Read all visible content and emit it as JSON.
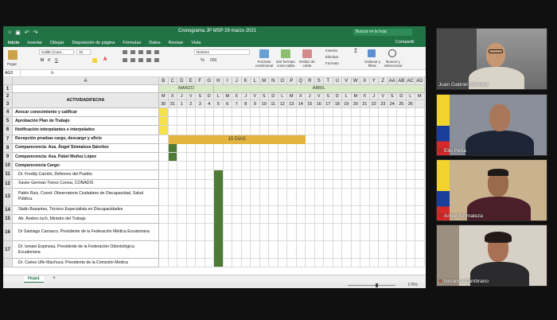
{
  "excel": {
    "qa_icons": [
      "home-icon",
      "save-icon",
      "undo-icon",
      "redo-icon"
    ],
    "title": "Cronograma JP MSP 29 marzo 2021",
    "search_placeholder": "Buscar en la hoja",
    "tabs": [
      "Inicio",
      "Insertar",
      "Dibujar",
      "Disposición de página",
      "Fórmulas",
      "Datos",
      "Revisar",
      "Vista"
    ],
    "share": "Compartir",
    "ribbon": {
      "paste": "Pegar",
      "font": "Calibri (Cuer...",
      "size": "10",
      "number_format": "Número",
      "conditional": "Formato condicional",
      "as_table": "Dar formato como tabla",
      "cell_styles": "Estilos de celda",
      "insert": "Insertar",
      "delete": "Eliminar",
      "format": "Formato",
      "sort": "Ordenar y filtrar",
      "find": "Buscar y seleccionar",
      "bold": "N",
      "italic": "K",
      "underline": "S",
      "font_a": "A",
      "percent": "%",
      "thousands": "000"
    },
    "name_box": "AG3",
    "fx": "fx",
    "grid": {
      "header_a": "A",
      "columns_after_a": [
        "B",
        "C",
        "D",
        "E",
        "F",
        "G",
        "H",
        "I",
        "J",
        "K",
        "L",
        "M",
        "N",
        "O",
        "P",
        "Q",
        "R",
        "S",
        "T",
        "U",
        "V",
        "W",
        "X",
        "Y",
        "Z",
        "AA",
        "AB",
        "AC",
        "AD"
      ],
      "month_marzo": "MARZO",
      "month_abril": "ABRIL",
      "weekdays": [
        "M",
        "X",
        "J",
        "V",
        "S",
        "D",
        "L",
        "M",
        "X",
        "J",
        "V",
        "S",
        "D",
        "L",
        "M",
        "X",
        "J",
        "V",
        "S",
        "D",
        "L",
        "M",
        "X",
        "J",
        "V",
        "S",
        "D",
        "L",
        "M"
      ],
      "days": [
        "30",
        "31",
        "1",
        "2",
        "3",
        "4",
        "5",
        "6",
        "7",
        "8",
        "9",
        "10",
        "11",
        "12",
        "13",
        "14",
        "15",
        "16",
        "17",
        "18",
        "19",
        "20",
        "21",
        "22",
        "23",
        "24",
        "25",
        "26",
        ""
      ],
      "header_label": "ACTIVIDAD/FECHA",
      "bar_label": "15 DÍAS",
      "row_numbers": [
        "1",
        "2",
        "3",
        "4",
        "5",
        "6",
        "7",
        "8",
        "9",
        "10",
        "11",
        "12",
        "13",
        "14",
        "15",
        "16",
        "17"
      ],
      "activities": [
        {
          "row": "4",
          "text": "Avocar conocimiento y calificar",
          "bold": true
        },
        {
          "row": "5",
          "text": "Aprobación  Plan de Trabajo",
          "bold": true
        },
        {
          "row": "6",
          "text": "Notificación interpelantes e interpelados",
          "bold": true
        },
        {
          "row": "7",
          "text": "Recepción pruebas cargo,  descargo y oficio",
          "bold": true
        },
        {
          "row": "8",
          "text": "Comparecencia: Asa. Ángel Sinmaleza Sánchez",
          "bold": true
        },
        {
          "row": "9",
          "text": "Comparecencia: Asa. Pabel Muñoz López",
          "bold": true
        },
        {
          "row": "10",
          "text": "Comparecencia Cargo:",
          "bold": true
        },
        {
          "row": "11",
          "text": "Dr. Freddy Carrión, Defensor del Pueblo.",
          "bold": false
        },
        {
          "row": "12",
          "text": "Xavier Germán Torres Correa, CONADIS",
          "bold": false
        },
        {
          "row": "13",
          "text": "Pablo Ruiz, Coord. Observatorio Ciudadano de Discapacidad, Salud Pública.",
          "bold": false
        },
        {
          "row": "14",
          "text": "Stalin Basantes, Técnico Especialista en Discapacidades",
          "bold": false
        },
        {
          "row": "15",
          "text": "Ab. Ándres Isch, Ministro del Trabajo",
          "bold": false
        },
        {
          "row": "16",
          "text": "Dr Santiago Carrasco, Presidente de la Federación Médica Ecuatoriana",
          "bold": false
        },
        {
          "row": "17",
          "text": "Dr. Ismael Espinosa, Presidente de la Federación Odontológica Ecuatoriana",
          "bold": false
        },
        {
          "row": "",
          "text": "Dr. Carlos Ulfe Machuca, Presidente de la Comisión Medica",
          "bold": false
        }
      ]
    },
    "sheet_tab": "Hoja1",
    "add_sheet": "+",
    "zoom": "176%"
  },
  "participants": [
    {
      "name": "Juan Gabriel Jimenez",
      "muted": false
    },
    {
      "name": "Elio Peña",
      "muted": true
    },
    {
      "name": "Angel Sinmaleza",
      "muted": true
    },
    {
      "name": "Noralma Zambrano",
      "muted": true
    }
  ],
  "colors": {
    "excel_green": "#217346",
    "yellow_fill": "#f5e14a",
    "orange_bar": "#e3b43f",
    "green_fill": "#4d7a35",
    "month_band": "#d9ebc6"
  }
}
